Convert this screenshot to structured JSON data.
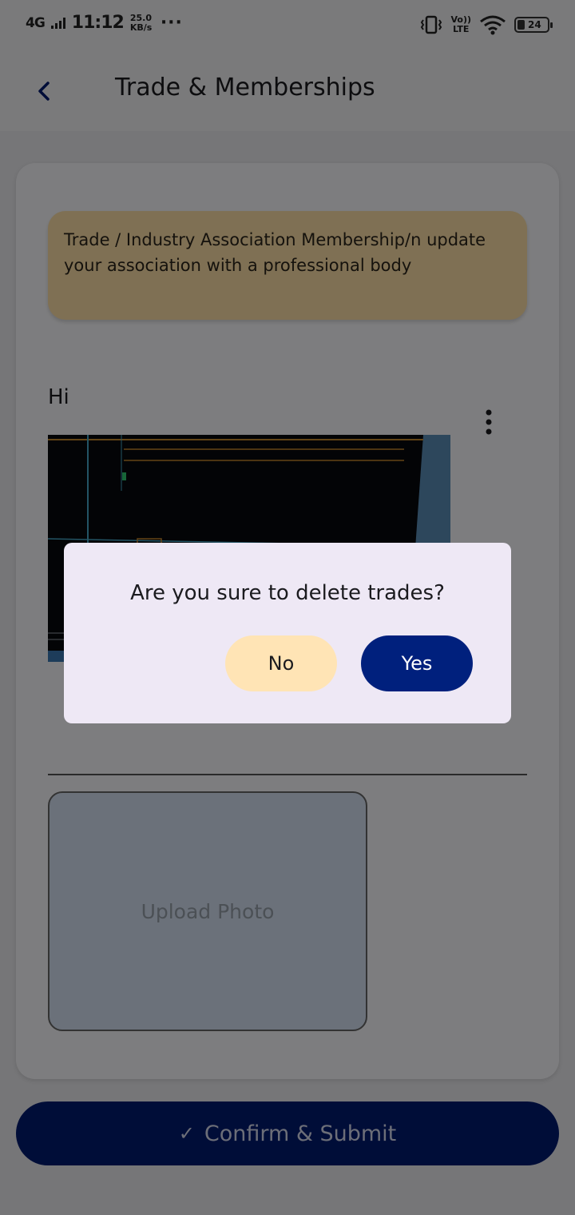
{
  "status_bar": {
    "network": "4G",
    "time": "11:12",
    "speed": "25.0",
    "speed_unit": "KB/s",
    "overflow": "···",
    "lte_top": "Vo))",
    "lte_bottom": "LTE",
    "battery": "24",
    "icons": [
      "vibrate-icon",
      "wifi-icon",
      "battery-icon"
    ]
  },
  "app_bar": {
    "title": "Trade & Memberships",
    "back_icon": "chevron-left-icon"
  },
  "banner": {
    "text": "Trade / Industry Association Membership/n update your association with a professional body"
  },
  "trade": {
    "name": "Hi",
    "menu_icon": "more-vertical-icon"
  },
  "upload": {
    "label": "Upload Photo"
  },
  "submit": {
    "label": "Confirm & Submit",
    "icon": "check-icon"
  },
  "dialog": {
    "message": "Are you sure to delete trades?",
    "no_label": "No",
    "yes_label": "Yes"
  },
  "colors": {
    "primary": "#00207d",
    "banner": "#ffe0a8",
    "no_button": "#ffe4b5",
    "dialog_bg": "#eee8f5"
  }
}
